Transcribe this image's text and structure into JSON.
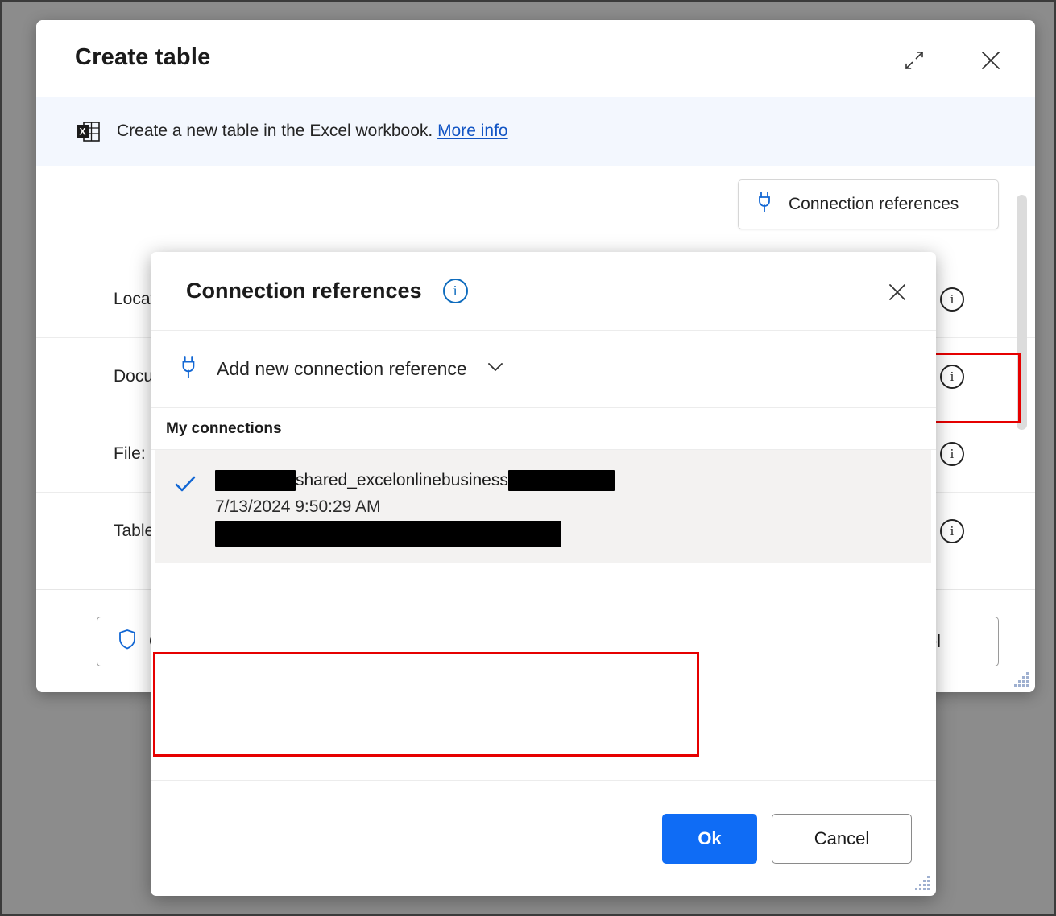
{
  "colors": {
    "accent_blue": "#0f6cf5",
    "link_blue": "#1154c4",
    "highlight_red": "#e60000",
    "banner_bg": "#f3f7fe",
    "selected_item_bg": "#f3f2f1",
    "desktop_bg": "#8c8c8c"
  },
  "create_table_dialog": {
    "title": "Create table",
    "expand_icon": "expand-diagonal-icon",
    "close_icon": "close-icon",
    "banner": {
      "icon": "excel-file-icon",
      "text": "Create a new table in the Excel workbook.",
      "link_label": "More info"
    },
    "connection_references_button": {
      "icon": "plug-icon",
      "label": "Connection references"
    },
    "form_rows": [
      {
        "label": "Location",
        "info_icon": "info-icon"
      },
      {
        "label": "Docume",
        "info_icon": "info-icon"
      },
      {
        "label": "File:",
        "info_icon": "info-icon"
      },
      {
        "label": "Table na",
        "info_icon": "info-icon"
      }
    ],
    "footer": {
      "security_button": {
        "icon": "shield-icon",
        "label": "On"
      },
      "cancel_button": "cel"
    },
    "scrollbar": {
      "name": "vertical-scrollbar"
    },
    "resize_grip": "resize-grip-icon"
  },
  "connection_references_dialog": {
    "title": "Connection references",
    "info_icon": "info-icon",
    "close_icon": "close-icon",
    "add_new": {
      "icon": "plug-icon",
      "label": "Add new connection reference",
      "chevron": "chevron-down-icon"
    },
    "section_header": "My connections",
    "items": [
      {
        "selected": true,
        "check_icon": "checkmark-icon",
        "name_prefix_redacted": true,
        "name_visible": "shared_excelonlinebusiness",
        "name_suffix_redacted": true,
        "timestamp": "7/13/2024 9:50:29 AM",
        "detail_redacted": true
      }
    ],
    "footer": {
      "ok_label": "Ok",
      "cancel_label": "Cancel"
    },
    "resize_grip": "resize-grip-icon"
  }
}
